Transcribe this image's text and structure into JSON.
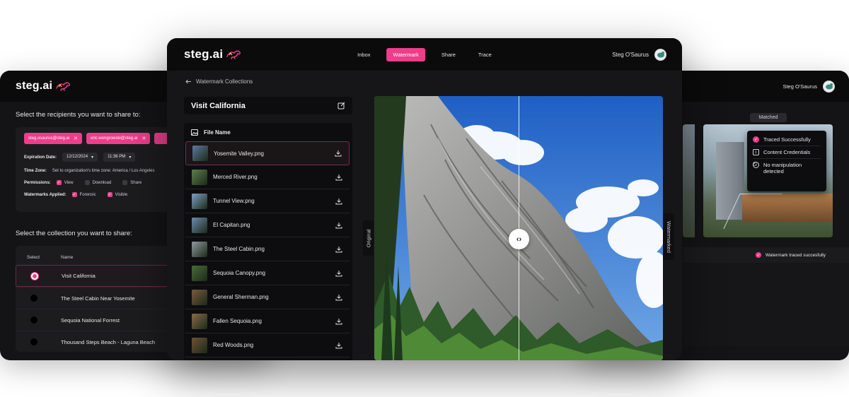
{
  "brand": {
    "name": "steg.ai",
    "accent": "#ee3d8b"
  },
  "user": {
    "name": "Steg O'Saurus"
  },
  "left_window": {
    "recipients_heading": "Select the recipients you want to share to:",
    "recipients": [
      {
        "email": "steg.osaurus@steg.ai"
      },
      {
        "email": "eric.wengrowski@steg.ai"
      }
    ],
    "expiration_label": "Expiration Date:",
    "expiration_date": "12/12/2024",
    "expiration_time": "11:36 PM",
    "timezone_label": "Time Zone:",
    "timezone_value": "Set to organization's time zone: America / Los Angeles",
    "permissions_label": "Permissions:",
    "permissions": [
      {
        "label": "View",
        "checked": true
      },
      {
        "label": "Download",
        "checked": false
      },
      {
        "label": "Share",
        "checked": false
      }
    ],
    "watermarks_label": "Watermarks Applied:",
    "watermarks": [
      {
        "label": "Forensic",
        "checked": true
      },
      {
        "label": "Visible",
        "checked": true
      }
    ],
    "collection_heading": "Select the collection you want to share:",
    "columns": {
      "select": "Select",
      "name": "Name"
    },
    "collections": [
      {
        "name": "Visit California",
        "selected": true
      },
      {
        "name": "The Steel Cabin Near Yosemite",
        "selected": false
      },
      {
        "name": "Sequoia National Forrest",
        "selected": false
      },
      {
        "name": "Thousand Steps Beach - Laguna Beach",
        "selected": false
      }
    ]
  },
  "main_window": {
    "tabs": [
      {
        "label": "Inbox",
        "active": false
      },
      {
        "label": "Watermark",
        "active": true
      },
      {
        "label": "Share",
        "active": false
      },
      {
        "label": "Trace",
        "active": false
      }
    ],
    "breadcrumb": "Watermark Collections",
    "collection_title": "Visit California",
    "files_header": "File Name",
    "files": [
      {
        "name": "Yosemite Valley.png",
        "selected": true,
        "thumb": "#5c7a9e"
      },
      {
        "name": "Merced River.png",
        "selected": false,
        "thumb": "#5e7f4f"
      },
      {
        "name": "Tunnel View.png",
        "selected": false,
        "thumb": "#7da0c4"
      },
      {
        "name": "El Capitan.png",
        "selected": false,
        "thumb": "#6b8cae"
      },
      {
        "name": "The Steel Cabin.png",
        "selected": false,
        "thumb": "#8f99a0"
      },
      {
        "name": "Sequoia Canopy.png",
        "selected": false,
        "thumb": "#4a6b3a"
      },
      {
        "name": "General Sherman.png",
        "selected": false,
        "thumb": "#7a5a3e"
      },
      {
        "name": "Fallen Sequoia.png",
        "selected": false,
        "thumb": "#8a6a4a"
      },
      {
        "name": "Red Woods.png",
        "selected": false,
        "thumb": "#6f5236"
      }
    ],
    "compare_left_label": "Original",
    "compare_right_label": "Watermarked"
  },
  "right_window": {
    "matched_label": "Matched",
    "trace_results": [
      {
        "label": "Traced Successfully",
        "icon": "check-circle-icon"
      },
      {
        "label": "Content Credentials",
        "icon": "cr-badge-icon"
      },
      {
        "label": "No manipulation detected",
        "icon": "no-icon"
      }
    ],
    "status_text": "Watermark traced succesfully"
  }
}
